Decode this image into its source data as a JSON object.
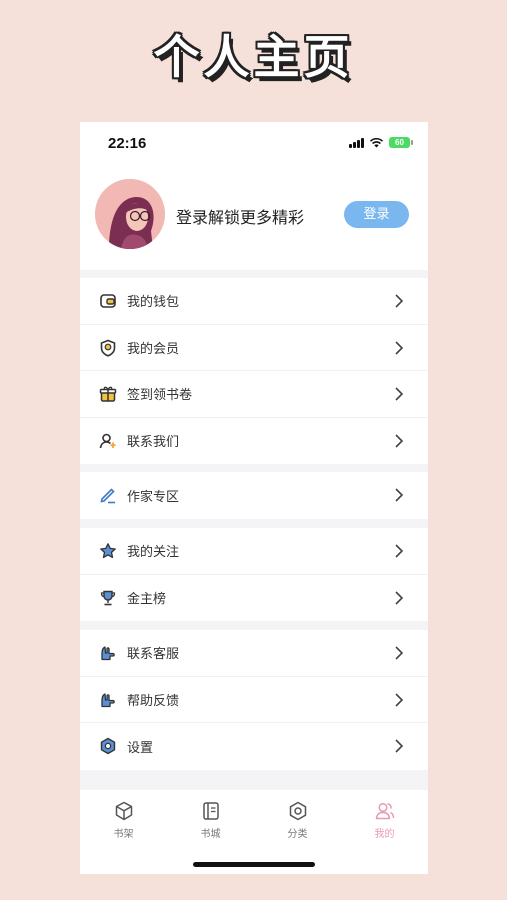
{
  "banner": {
    "title": "个人主页"
  },
  "status": {
    "time": "22:16",
    "battery": "60"
  },
  "profile": {
    "login_tip": "登录解锁更多精彩",
    "login_button": "登录"
  },
  "menu": {
    "group1": [
      {
        "label": "我的钱包",
        "icon": "wallet-icon"
      },
      {
        "label": "我的会员",
        "icon": "member-badge-icon"
      },
      {
        "label": "签到领书卷",
        "icon": "gift-icon"
      },
      {
        "label": "联系我们",
        "icon": "contact-person-icon"
      }
    ],
    "group2": [
      {
        "label": "作家专区",
        "icon": "pen-icon"
      }
    ],
    "group3": [
      {
        "label": "我的关注",
        "icon": "star-icon"
      },
      {
        "label": "金主榜",
        "icon": "trophy-icon"
      }
    ],
    "group4": [
      {
        "label": "联系客服",
        "icon": "service-icon"
      },
      {
        "label": "帮助反馈",
        "icon": "feedback-icon"
      },
      {
        "label": "设置",
        "icon": "settings-icon"
      }
    ]
  },
  "tabs": [
    {
      "label": "书架",
      "icon": "bookshelf-icon",
      "active": false
    },
    {
      "label": "书城",
      "icon": "bookstore-icon",
      "active": false
    },
    {
      "label": "分类",
      "icon": "category-icon",
      "active": false
    },
    {
      "label": "我的",
      "icon": "profile-icon",
      "active": true
    }
  ],
  "colors": {
    "accent": "#7bb7ef",
    "active_tab": "#e79bb0",
    "background": "#f5e1da"
  }
}
